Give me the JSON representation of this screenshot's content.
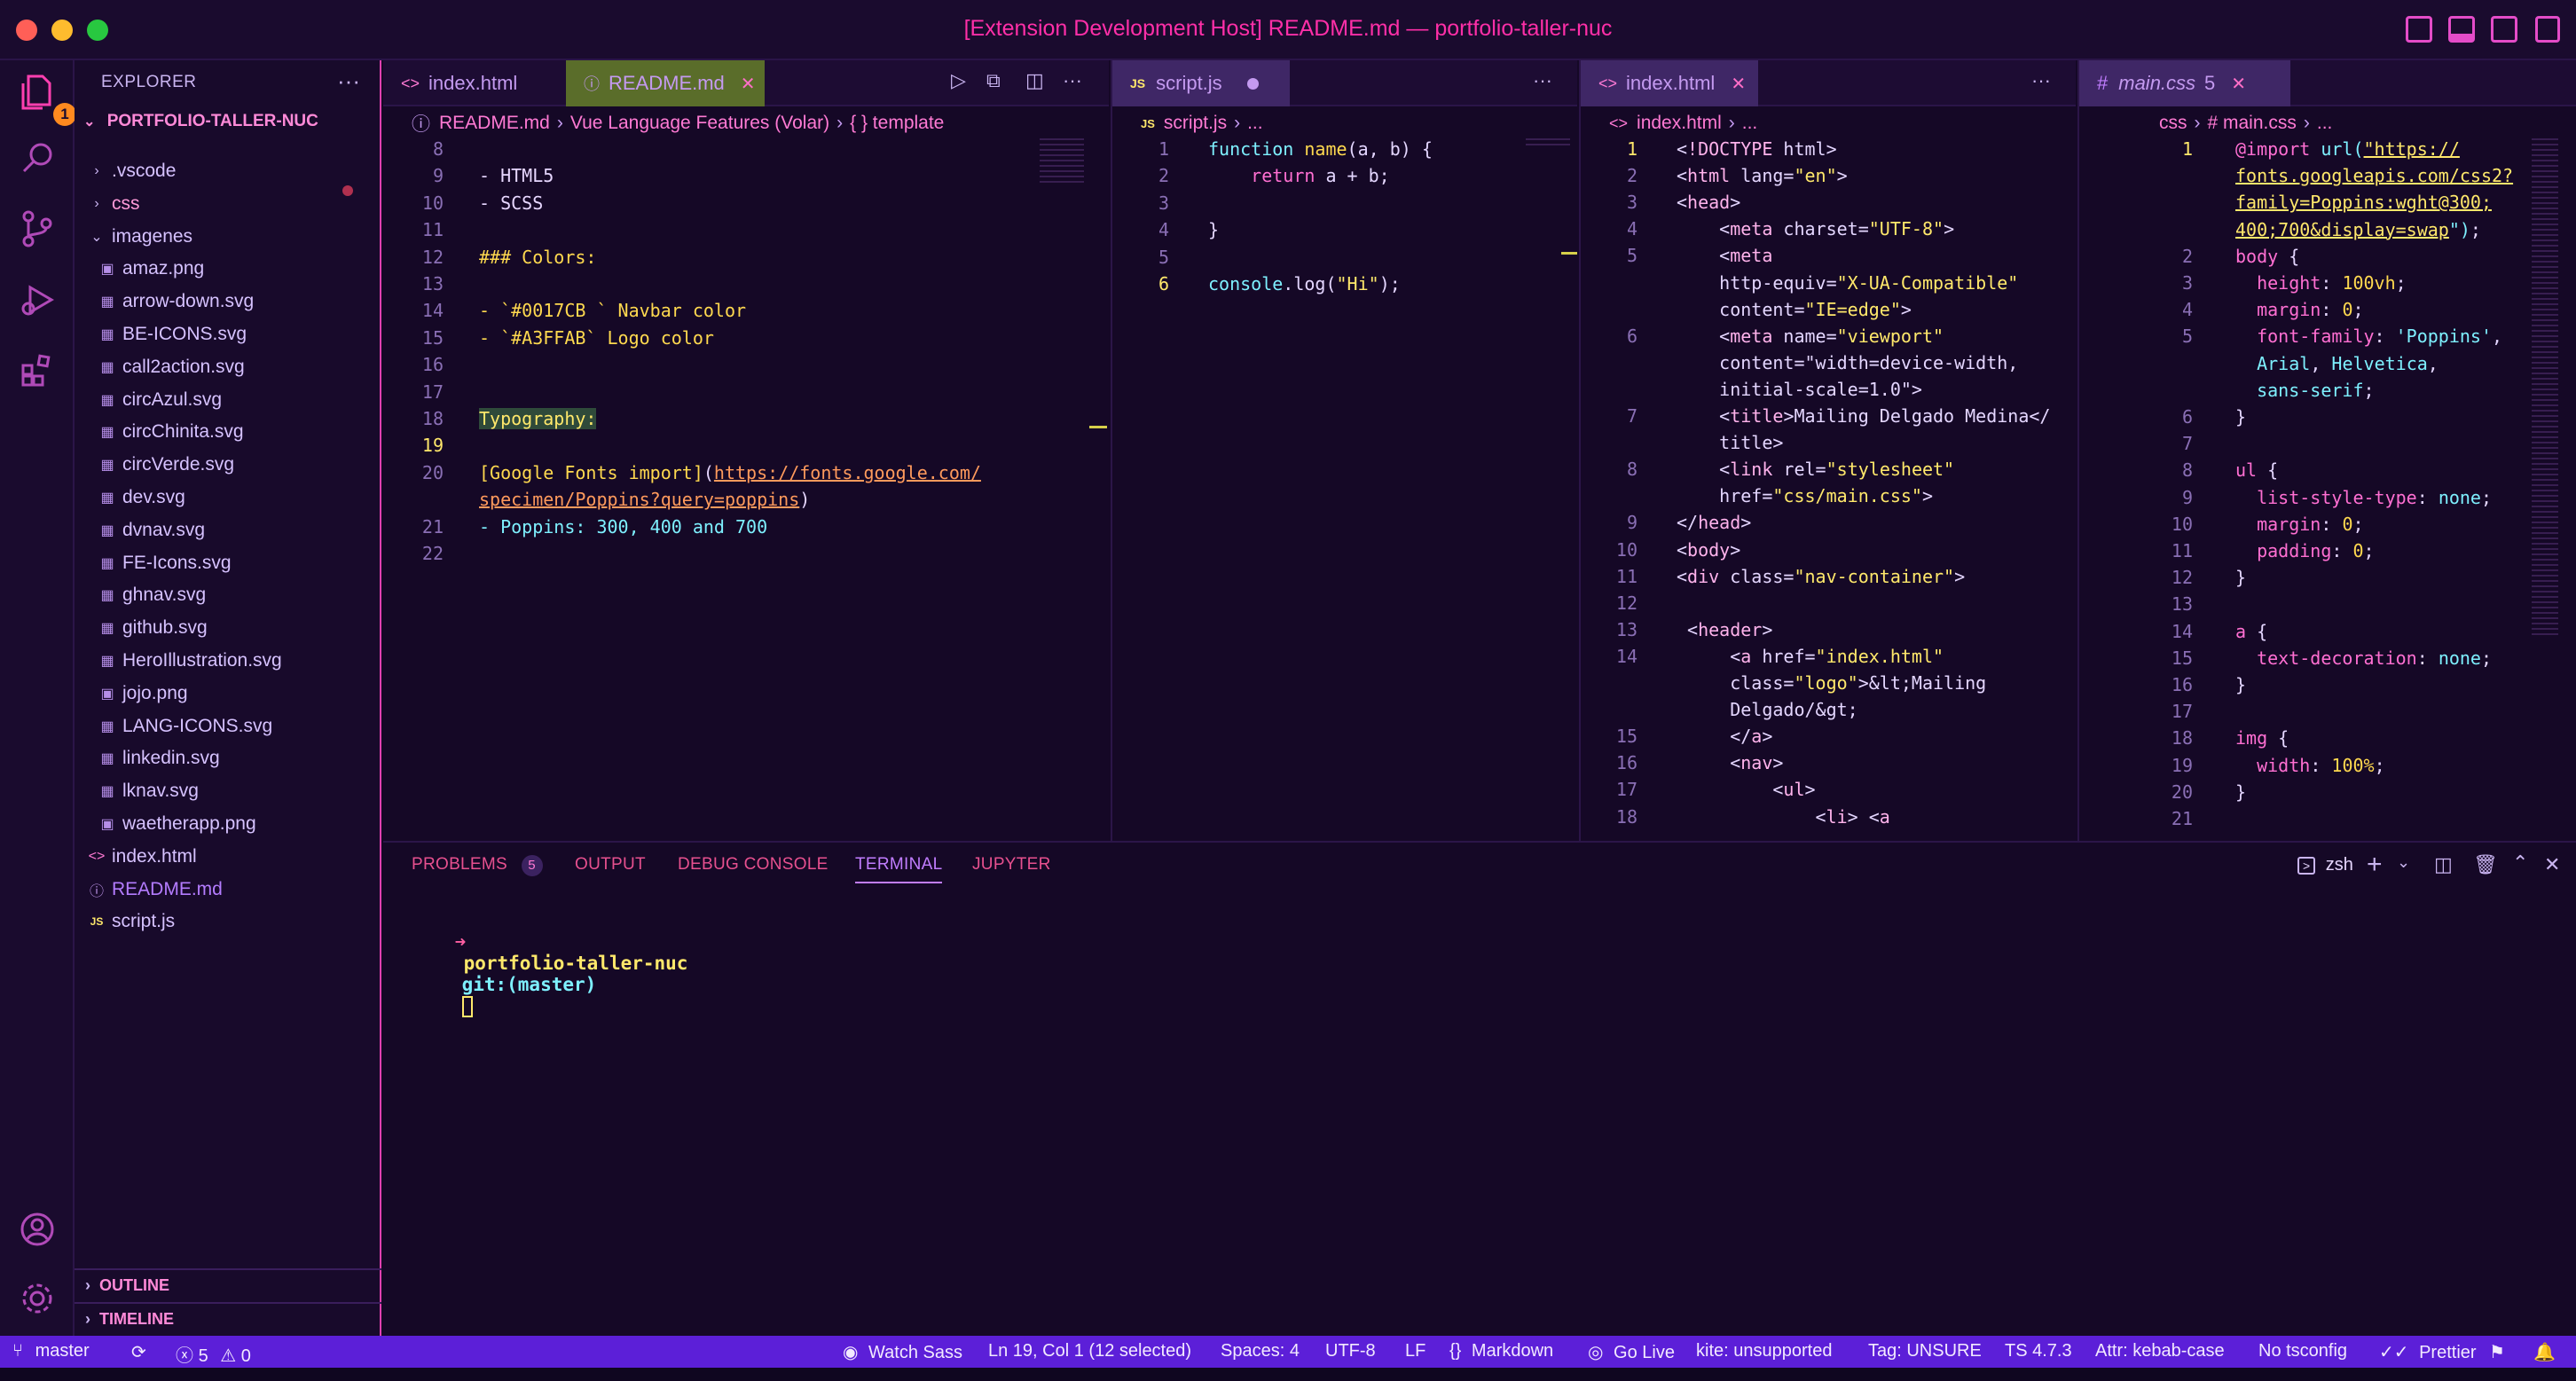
{
  "window": {
    "title": "[Extension Development Host] README.md — portfolio-taller-nuc"
  },
  "activity_bar": {
    "explorer_badge": "1"
  },
  "explorer": {
    "header": "EXPLORER",
    "more": "···",
    "root": "PORTFOLIO-TALLER-NUC",
    "items": [
      {
        "label": ".vscode",
        "icon": "chevron-right",
        "depth": 0
      },
      {
        "label": "css",
        "icon": "chevron-right",
        "depth": 0
      },
      {
        "label": "imagenes",
        "icon": "chevron-down",
        "depth": 0
      },
      {
        "label": "amaz.png",
        "icon": "image",
        "depth": 1
      },
      {
        "label": "arrow-down.svg",
        "icon": "svg",
        "depth": 1
      },
      {
        "label": "BE-ICONS.svg",
        "icon": "svg",
        "depth": 1
      },
      {
        "label": "call2action.svg",
        "icon": "svg",
        "depth": 1
      },
      {
        "label": "circAzul.svg",
        "icon": "svg",
        "depth": 1
      },
      {
        "label": "circChinita.svg",
        "icon": "svg",
        "depth": 1
      },
      {
        "label": "circVerde.svg",
        "icon": "svg",
        "depth": 1
      },
      {
        "label": "dev.svg",
        "icon": "svg",
        "depth": 1
      },
      {
        "label": "dvnav.svg",
        "icon": "svg",
        "depth": 1
      },
      {
        "label": "FE-Icons.svg",
        "icon": "svg",
        "depth": 1
      },
      {
        "label": "ghnav.svg",
        "icon": "svg",
        "depth": 1
      },
      {
        "label": "github.svg",
        "icon": "svg",
        "depth": 1
      },
      {
        "label": "HeroIllustration.svg",
        "icon": "svg",
        "depth": 1
      },
      {
        "label": "jojo.png",
        "icon": "image",
        "depth": 1
      },
      {
        "label": "LANG-ICONS.svg",
        "icon": "svg",
        "depth": 1
      },
      {
        "label": "linkedin.svg",
        "icon": "svg",
        "depth": 1
      },
      {
        "label": "lknav.svg",
        "icon": "svg",
        "depth": 1
      },
      {
        "label": "waetherapp.png",
        "icon": "image",
        "depth": 1
      },
      {
        "label": "index.html",
        "icon": "html",
        "depth": 0
      },
      {
        "label": "README.md",
        "icon": "info",
        "depth": 0
      },
      {
        "label": "script.js",
        "icon": "js",
        "depth": 0
      }
    ],
    "outline": "OUTLINE",
    "timeline": "TIMELINE"
  },
  "group1": {
    "tabs": [
      {
        "label": "index.html",
        "icon": "<>"
      },
      {
        "label": "README.md",
        "icon": "ⓘ"
      }
    ],
    "breadcrumb": [
      "README.md",
      "Vue Language Features (Volar)",
      "{ } template"
    ],
    "lines": [
      {
        "n": "8",
        "text": ""
      },
      {
        "n": "9",
        "text": "- HTML5"
      },
      {
        "n": "10",
        "text": "- SCSS"
      },
      {
        "n": "11",
        "text": ""
      },
      {
        "n": "12",
        "text": "### Colors:"
      },
      {
        "n": "13",
        "text": ""
      },
      {
        "n": "14",
        "text": "- `#0017CB ` Navbar color"
      },
      {
        "n": "15",
        "text": "- `#A3FFAB` Logo color"
      },
      {
        "n": "16",
        "text": ""
      },
      {
        "n": "17",
        "text": ""
      },
      {
        "n": "18",
        "text": "Typography:"
      },
      {
        "n": "19",
        "text": ""
      },
      {
        "n": "20",
        "text": "[Google Fonts import](https://fonts.google.com/"
      },
      {
        "n": "",
        "text": "specimen/Poppins?query=poppins)"
      },
      {
        "n": "21",
        "text": "- Poppins: 300, 400 and 700"
      },
      {
        "n": "22",
        "text": ""
      }
    ]
  },
  "group2": {
    "tab": {
      "label": "script.js",
      "icon": "JS"
    },
    "breadcrumb": [
      "script.js",
      "..."
    ],
    "lines": [
      {
        "n": "1",
        "text": "function name(a, b) {"
      },
      {
        "n": "2",
        "text": "    return a + b;"
      },
      {
        "n": "3",
        "text": ""
      },
      {
        "n": "4",
        "text": "}"
      },
      {
        "n": "5",
        "text": ""
      },
      {
        "n": "6",
        "text": "console.log(\"Hi\");"
      }
    ]
  },
  "group3": {
    "tab": {
      "label": "index.html",
      "icon": "<>"
    },
    "breadcrumb": [
      "index.html",
      "..."
    ],
    "lines": [
      {
        "n": "1",
        "text": "<!DOCTYPE html>"
      },
      {
        "n": "2",
        "text": "<html lang=\"en\">"
      },
      {
        "n": "3",
        "text": "<head>"
      },
      {
        "n": "4",
        "text": "    <meta charset=\"UTF-8\">"
      },
      {
        "n": "5",
        "text": "    <meta"
      },
      {
        "n": "",
        "text": "    http-equiv=\"X-UA-Compatible\""
      },
      {
        "n": "",
        "text": "    content=\"IE=edge\">"
      },
      {
        "n": "6",
        "text": "    <meta name=\"viewport\""
      },
      {
        "n": "",
        "text": "    content=\"width=device-width,"
      },
      {
        "n": "",
        "text": "    initial-scale=1.0\">"
      },
      {
        "n": "7",
        "text": "    <title>Mailing Delgado Medina</"
      },
      {
        "n": "",
        "text": "    title>"
      },
      {
        "n": "8",
        "text": "    <link rel=\"stylesheet\""
      },
      {
        "n": "",
        "text": "    href=\"css/main.css\">"
      },
      {
        "n": "9",
        "text": "</head>"
      },
      {
        "n": "10",
        "text": "<body>"
      },
      {
        "n": "11",
        "text": "<div class=\"nav-container\">"
      },
      {
        "n": "12",
        "text": ""
      },
      {
        "n": "13",
        "text": " <header>"
      },
      {
        "n": "14",
        "text": "     <a href=\"index.html\""
      },
      {
        "n": "",
        "text": "     class=\"logo\">&lt;Mailing"
      },
      {
        "n": "",
        "text": "     Delgado/&gt;"
      },
      {
        "n": "15",
        "text": "     </a>"
      },
      {
        "n": "16",
        "text": "     <nav>"
      },
      {
        "n": "17",
        "text": "         <ul>"
      },
      {
        "n": "18",
        "text": "             <li> <a"
      }
    ]
  },
  "group4": {
    "tab": {
      "label": "main.css",
      "icon": "#",
      "problems": "5"
    },
    "breadcrumb": [
      "css",
      "# main.css",
      "..."
    ],
    "lines": [
      {
        "n": "1",
        "text": "@import url(\"https://"
      },
      {
        "n": "",
        "text": "fonts.googleapis.com/css2?"
      },
      {
        "n": "",
        "text": "family=Poppins:wght@300;"
      },
      {
        "n": "",
        "text": "400;700&display=swap\");"
      },
      {
        "n": "2",
        "text": "body {"
      },
      {
        "n": "3",
        "text": "  height: 100vh;"
      },
      {
        "n": "4",
        "text": "  margin: 0;"
      },
      {
        "n": "5",
        "text": "  font-family: 'Poppins',"
      },
      {
        "n": "",
        "text": "  Arial, Helvetica,"
      },
      {
        "n": "",
        "text": "  sans-serif;"
      },
      {
        "n": "6",
        "text": "}"
      },
      {
        "n": "7",
        "text": ""
      },
      {
        "n": "8",
        "text": "ul {"
      },
      {
        "n": "9",
        "text": "  list-style-type: none;"
      },
      {
        "n": "10",
        "text": "  margin: 0;"
      },
      {
        "n": "11",
        "text": "  padding: 0;"
      },
      {
        "n": "12",
        "text": "}"
      },
      {
        "n": "13",
        "text": ""
      },
      {
        "n": "14",
        "text": "a {"
      },
      {
        "n": "15",
        "text": "  text-decoration: none;"
      },
      {
        "n": "16",
        "text": "}"
      },
      {
        "n": "17",
        "text": ""
      },
      {
        "n": "18",
        "text": "img {"
      },
      {
        "n": "19",
        "text": "  width: 100%;"
      },
      {
        "n": "20",
        "text": "}"
      },
      {
        "n": "21",
        "text": ""
      }
    ]
  },
  "panel": {
    "tabs": {
      "problems": "PROBLEMS",
      "problems_count": "5",
      "output": "OUTPUT",
      "debug_console": "DEBUG CONSOLE",
      "terminal": "TERMINAL",
      "jupyter": "JUPYTER"
    },
    "shell": "zsh",
    "terminal": {
      "arrow": "➜",
      "dir": "portfolio-taller-nuc",
      "git": "git:(master)"
    }
  },
  "statusbar": {
    "branch": "master",
    "errors": "5",
    "warnings": "0",
    "watch_sass": "Watch Sass",
    "cursor": "Ln 19, Col 1 (12 selected)",
    "spaces": "Spaces: 4",
    "encoding": "UTF-8",
    "eol": "LF",
    "language": "Markdown",
    "go_live": "Go Live",
    "kite": "kite: unsupported",
    "tag": "Tag: UNSURE",
    "ts": "TS 4.7.3",
    "attr": "Attr: kebab-case",
    "tsconfig": "No tsconfig",
    "prettier": "Prettier"
  }
}
